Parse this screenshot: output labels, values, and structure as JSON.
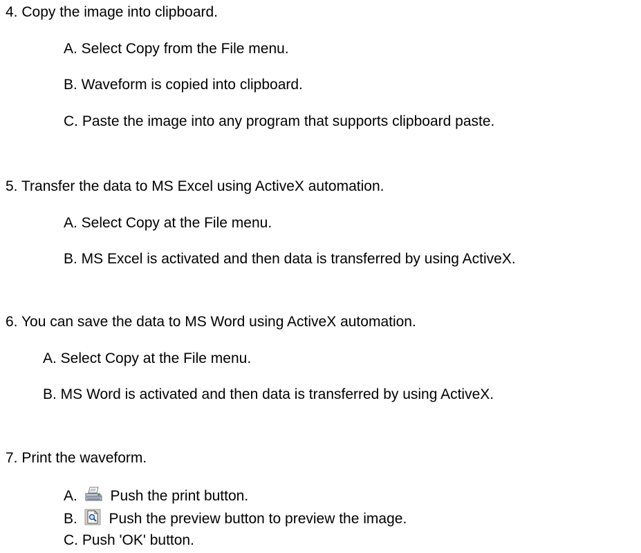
{
  "sections": [
    {
      "heading": "4. Copy the image into clipboard.",
      "steps": [
        "A. Select Copy from the File menu.",
        "B. Waveform is copied into clipboard.",
        "C. Paste the image into any program that supports clipboard paste."
      ]
    },
    {
      "heading": "5. Transfer the data to MS Excel using ActiveX automation.",
      "steps": [
        "A. Select Copy at the File menu.",
        "B. MS Excel is activated and then data is transferred by using ActiveX."
      ]
    },
    {
      "heading": "6. You can save the data to MS Word using ActiveX automation.",
      "steps": [
        "A. Select Copy at the File menu.",
        "B. MS Word is activated and then data is transferred by using ActiveX."
      ]
    },
    {
      "heading": "7. Print the waveform.",
      "steps": [
        {
          "prefix": "A.",
          "icon": "printer-icon",
          "text": "Push the print button."
        },
        {
          "prefix": "B.",
          "icon": "print-preview-icon",
          "text": "Push the preview button to preview the image."
        },
        "C. Push 'OK' button."
      ]
    }
  ]
}
